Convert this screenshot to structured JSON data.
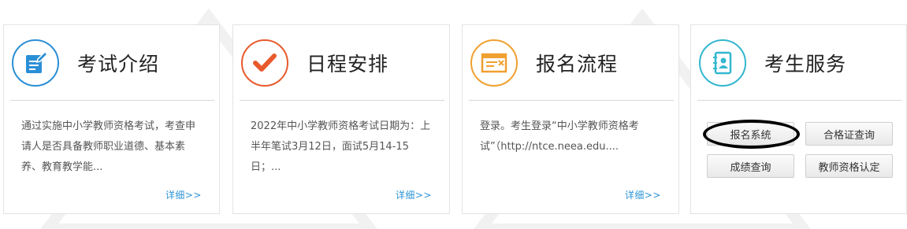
{
  "cards": [
    {
      "title": "考试介绍",
      "icon": "document-edit-icon",
      "accent": "#2b8fd6",
      "desc": "通过实施中小学教师资格考试，考查申请人是否具备教师职业道德、基本素养、教育教学能...",
      "more": "详细>>"
    },
    {
      "title": "日程安排",
      "icon": "check-mark-icon",
      "accent": "#e85a2c",
      "desc": "2022年中小学教师资格考试日期为：上半年笔试3月12日，面试5月14-15日；...",
      "more": "详细>>"
    },
    {
      "title": "报名流程",
      "icon": "browser-form-icon",
      "accent": "#f0a030",
      "desc": "登录。考生登录“中小学教师资格考试”（http://ntce.neea.edu....",
      "more": "详细>>"
    },
    {
      "title": "考生服务",
      "icon": "contacts-book-icon",
      "accent": "#33b7cf"
    }
  ],
  "services": {
    "buttons": [
      "报名系统",
      "合格证查询",
      "成绩查询",
      "教师资格认定"
    ]
  },
  "colors": {
    "link": "#2b94d6",
    "border": "#e3e3e3",
    "annotation_ring": "#000000"
  }
}
